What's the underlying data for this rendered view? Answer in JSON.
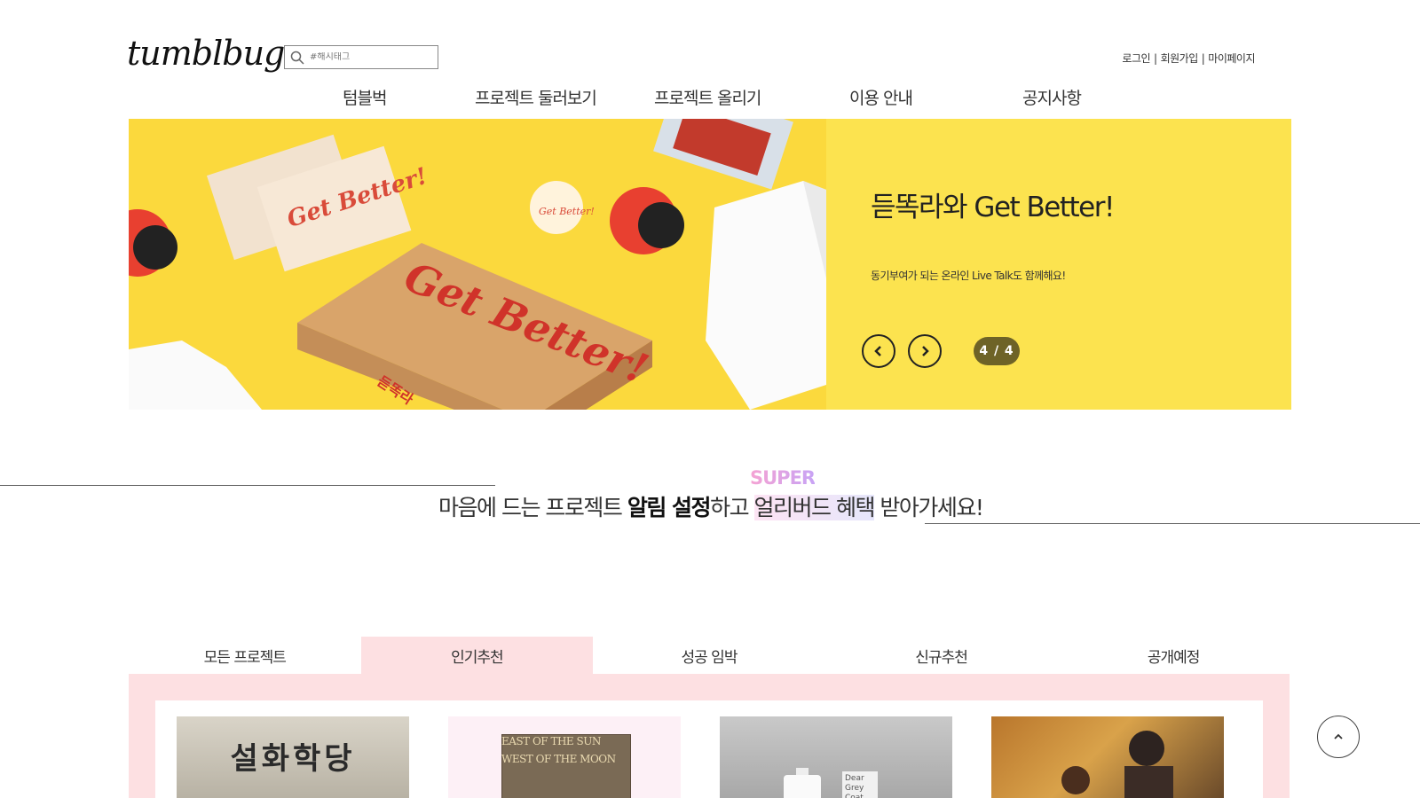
{
  "header": {
    "logo": "tumblbug",
    "search_placeholder": "#해시태그",
    "auth": {
      "login": "로그인",
      "signup": "회원가입",
      "mypage": "마이페이지",
      "separator": "|"
    }
  },
  "nav": {
    "items": [
      "텀블벅",
      "프로젝트 둘러보기",
      "프로젝트 올리기",
      "이용 안내",
      "공지사항"
    ]
  },
  "banner": {
    "title": "듣똑라와 Get Better!",
    "subtitle": "동기부여가 되는 온라인 Live Talk도 함께해요!",
    "counter": "4 / 4",
    "art_text": {
      "postcard": "Get Better!",
      "box": "Get Better!",
      "popsocket": "Get Better!",
      "box_side": "듣똑라"
    },
    "colors": {
      "background": "#fce34f",
      "counter_bg": "#6e6327"
    }
  },
  "promo": {
    "super": "SUPER",
    "text_pre": "마음에 드는 프로젝트 ",
    "text_bold": "알림 설정",
    "text_mid": "하고 ",
    "text_highlight": "얼리버드 혜택",
    "text_post": " 받아가세요!"
  },
  "tabs": {
    "items": [
      "모든 프로젝트",
      "인기추천",
      "성공 임박",
      "신규추천",
      "공개예정"
    ],
    "active_index": 1,
    "active_color": "#fde0e2"
  },
  "cards": [
    {
      "image_text": "설화학당"
    },
    {
      "image_text_1": "EAST OF THE SUN",
      "image_text_2": "WEST OF THE MOON"
    },
    {
      "label": "Dear Grey Coat"
    },
    {
      "image_text": ""
    }
  ]
}
